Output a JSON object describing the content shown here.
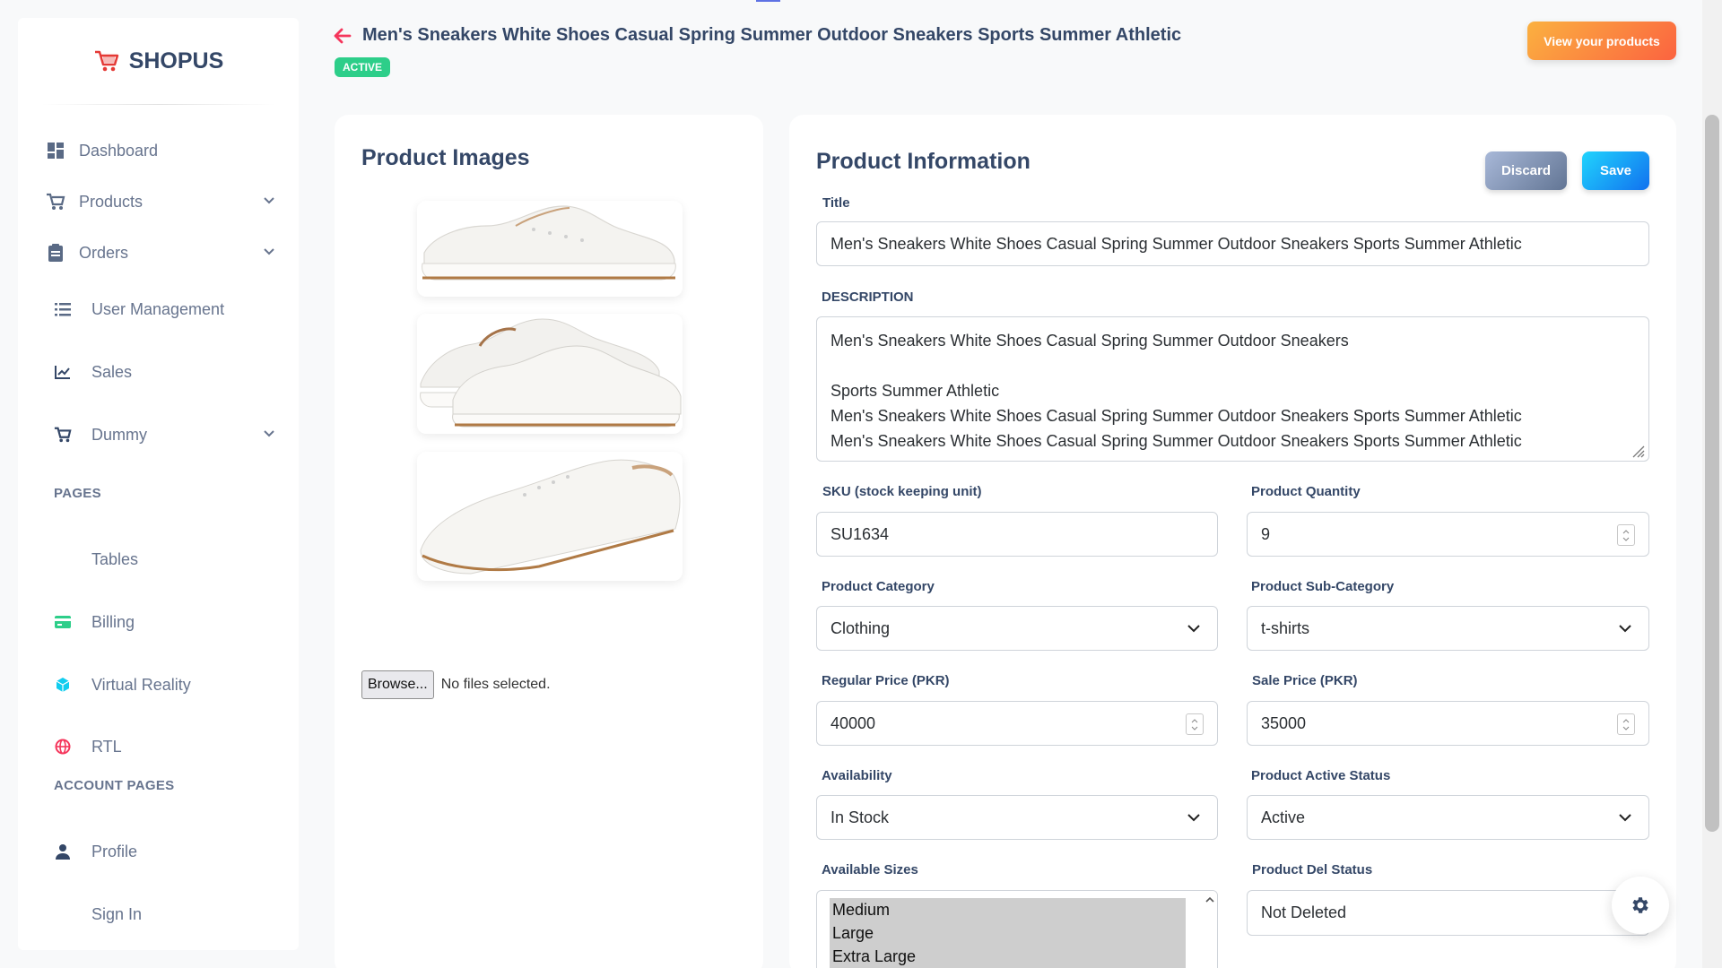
{
  "brand": {
    "name": "SHOPUS"
  },
  "sidebar": {
    "items": [
      {
        "label": "Dashboard",
        "icon": "dashboard-icon"
      },
      {
        "label": "Products",
        "icon": "cart-icon"
      },
      {
        "label": "Orders",
        "icon": "clipboard-icon"
      },
      {
        "label": "User Management",
        "icon": "list-icon"
      },
      {
        "label": "Sales",
        "icon": "chart-icon"
      },
      {
        "label": "Dummy",
        "icon": "cart-icon"
      },
      {
        "label": "Tables",
        "icon": ""
      },
      {
        "label": "Billing",
        "icon": "credit-card-icon"
      },
      {
        "label": "Virtual Reality",
        "icon": "cube-icon"
      },
      {
        "label": "RTL",
        "icon": "globe-icon"
      },
      {
        "label": "Profile",
        "icon": "user-icon"
      },
      {
        "label": "Sign In",
        "icon": ""
      }
    ],
    "section_pages": "PAGES",
    "section_account": "ACCOUNT PAGES"
  },
  "header": {
    "title": "Men's Sneakers White Shoes Casual Spring Summer Outdoor Sneakers Sports Summer Athletic",
    "status_badge": "ACTIVE",
    "view_products_label": "View your products"
  },
  "images_card": {
    "title": "Product Images",
    "browse_label": "Browse...",
    "file_status": "No files selected."
  },
  "info_card": {
    "title": "Product Information",
    "discard_label": "Discard",
    "save_label": "Save",
    "title_label": "Title",
    "title_value": "Men's Sneakers White Shoes Casual Spring Summer Outdoor Sneakers Sports Summer Athletic",
    "description_label": "DESCRIPTION",
    "description_value": "Men's Sneakers White Shoes Casual Spring Summer Outdoor Sneakers\n\nSports Summer Athletic\nMen's Sneakers White Shoes Casual Spring Summer Outdoor Sneakers Sports Summer Athletic\nMen's Sneakers White Shoes Casual Spring Summer Outdoor Sneakers Sports Summer Athletic",
    "sku_label": "SKU (stock keeping unit)",
    "sku_value": "SU1634",
    "quantity_label": "Product Quantity",
    "quantity_value": "9",
    "category_label": "Product Category",
    "category_value": "Clothing",
    "subcategory_label": "Product Sub-Category",
    "subcategory_value": "t-shirts",
    "regular_price_label": "Regular Price (PKR)",
    "regular_price_value": "40000",
    "sale_price_label": "Sale Price (PKR)",
    "sale_price_value": "35000",
    "availability_label": "Availability",
    "availability_value": "In Stock",
    "active_status_label": "Product Active Status",
    "active_status_value": "Active",
    "sizes_label": "Available Sizes",
    "sizes_options": [
      "Medium",
      "Large",
      "Extra Large"
    ],
    "del_status_label": "Product Del Status",
    "del_status_value": "Not Deleted"
  },
  "colors": {
    "accent_orange": "#fb6340",
    "active_green": "#2dce89",
    "save_blue": "#1171ef",
    "back_arrow": "#f5365c"
  }
}
